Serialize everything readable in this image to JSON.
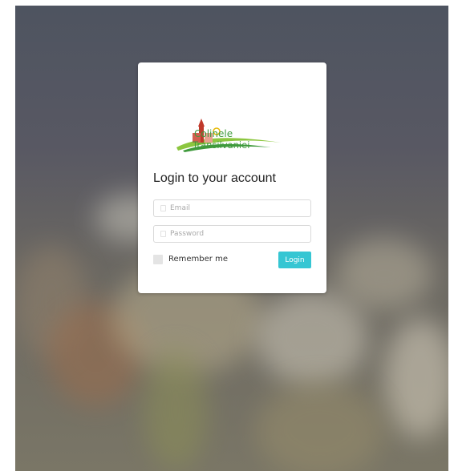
{
  "logo": {
    "line1": "Colinele",
    "line2": "Transilvaniei"
  },
  "login": {
    "heading": "Login to your account",
    "email_placeholder": "Email",
    "password_placeholder": "Password",
    "remember_label": "Remember me",
    "button_label": "Login"
  },
  "colors": {
    "accent": "#36c6d3",
    "logo_green": "#3f9a3c",
    "logo_red": "#c0392b"
  }
}
